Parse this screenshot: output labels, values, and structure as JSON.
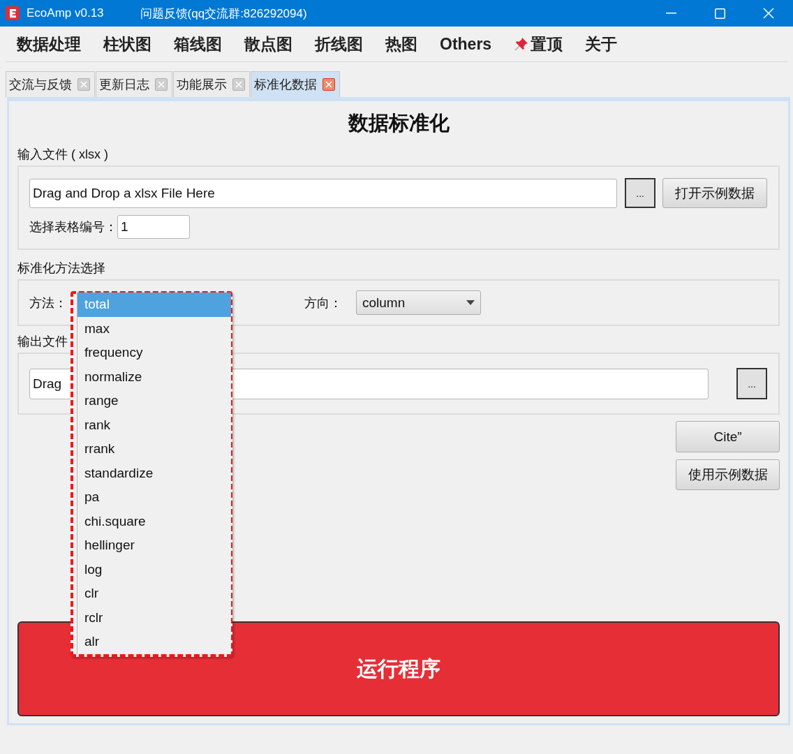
{
  "window": {
    "title": "EcoAmp v0.13",
    "subtitle": "问题反馈(qq交流群:826292094)"
  },
  "menu": [
    {
      "label": "数据处理",
      "kind": "text"
    },
    {
      "label": "柱状图",
      "kind": "text"
    },
    {
      "label": "箱线图",
      "kind": "text"
    },
    {
      "label": "散点图",
      "kind": "text"
    },
    {
      "label": "折线图",
      "kind": "text"
    },
    {
      "label": "热图",
      "kind": "text"
    },
    {
      "label": "Others",
      "kind": "text"
    },
    {
      "label": "置顶",
      "kind": "pin"
    },
    {
      "label": "关于",
      "kind": "text"
    }
  ],
  "tabs": [
    {
      "label": "交流与反馈",
      "selected": false
    },
    {
      "label": "更新日志",
      "selected": false
    },
    {
      "label": "功能展示",
      "selected": false
    },
    {
      "label": "标准化数据",
      "selected": true
    }
  ],
  "page": {
    "title": "数据标准化",
    "input_group": {
      "label": "输入文件 ( xlsx )",
      "file_field": {
        "value": "Drag and Drop a xlsx File Here"
      },
      "browse_button": "...",
      "example_button": "打开示例数据",
      "sheet_label": "选择表格编号：",
      "sheet_field": {
        "value": "1"
      }
    },
    "method_group": {
      "label": "标准化方法选择",
      "method_label": "方法：",
      "direction_label": "方向：",
      "direction": {
        "value": "column"
      }
    },
    "output_group": {
      "label": "输出文件",
      "file_field": {
        "value": "Drag"
      },
      "browse_button": "..."
    },
    "cite_button": "Cite”",
    "example_button": "使用示例数据",
    "run_button": "运行程序"
  },
  "dropdown": {
    "options": [
      {
        "label": "total",
        "selected": true
      },
      {
        "label": "max",
        "selected": false
      },
      {
        "label": "frequency",
        "selected": false
      },
      {
        "label": "normalize",
        "selected": false
      },
      {
        "label": "range",
        "selected": false
      },
      {
        "label": "rank",
        "selected": false
      },
      {
        "label": "rrank",
        "selected": false
      },
      {
        "label": "standardize",
        "selected": false
      },
      {
        "label": "pa",
        "selected": false
      },
      {
        "label": "chi.square",
        "selected": false
      },
      {
        "label": "hellinger",
        "selected": false
      },
      {
        "label": "log",
        "selected": false
      },
      {
        "label": "clr",
        "selected": false
      },
      {
        "label": "rclr",
        "selected": false
      },
      {
        "label": "alr",
        "selected": false
      }
    ]
  }
}
